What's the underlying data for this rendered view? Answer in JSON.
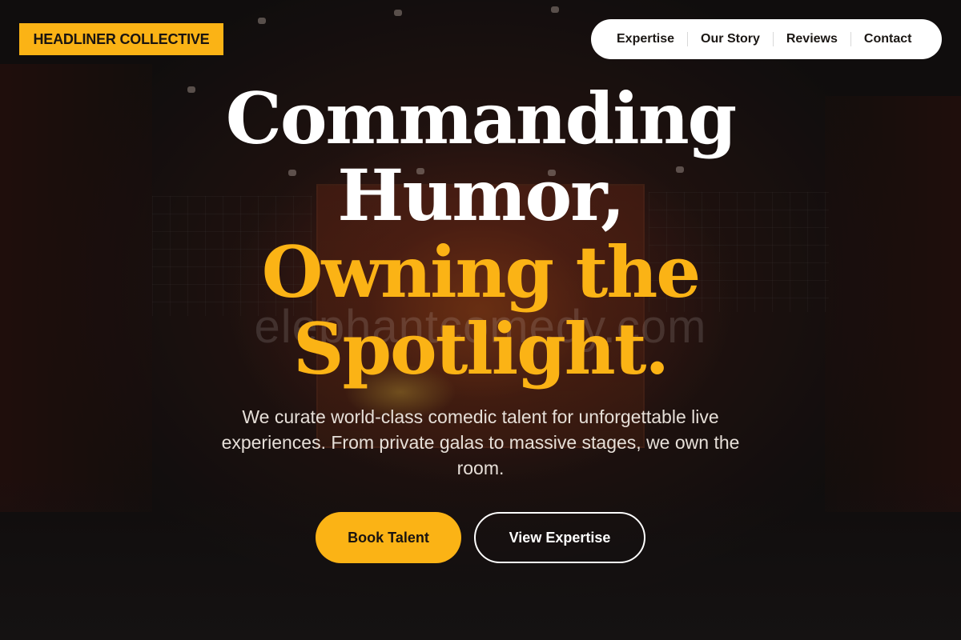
{
  "brand": {
    "name": "HEADLINER COLLECTIVE"
  },
  "nav": {
    "items": [
      {
        "label": "Expertise"
      },
      {
        "label": "Our Story"
      },
      {
        "label": "Reviews"
      },
      {
        "label": "Contact"
      }
    ]
  },
  "hero": {
    "headline_line1": "Commanding",
    "headline_line2": "Humor,",
    "headline_line3": "Owning the",
    "headline_line4": "Spotlight.",
    "subtitle": "We curate world-class comedic talent for unforgettable live experiences. From private galas to massive stages, we own the room.",
    "watermark": "elephantcomedy.com",
    "primary_cta": "Book Talent",
    "secondary_cta": "View Expertise"
  },
  "colors": {
    "accent": "#fbb315",
    "background": "#151212",
    "text_light": "#ffffff",
    "nav_bg": "#ffffff"
  }
}
